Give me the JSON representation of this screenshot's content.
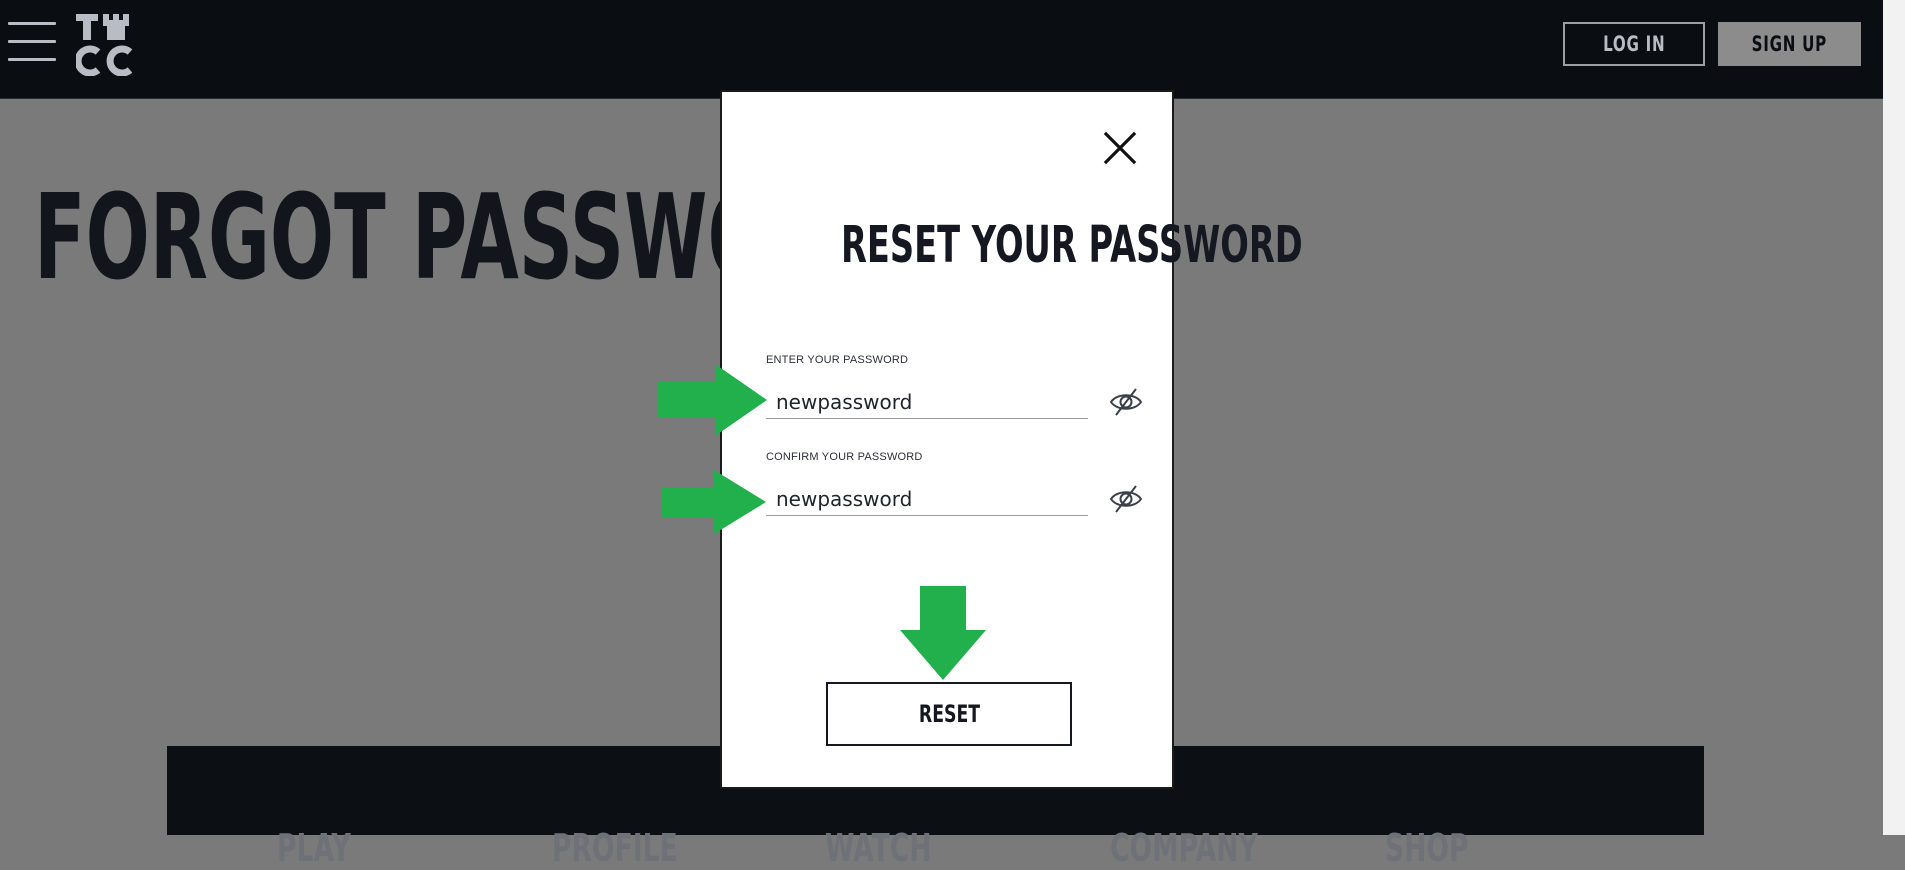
{
  "header": {
    "logo_text": "TMCC",
    "login_label": "LOG IN",
    "signup_label": "SIGN UP"
  },
  "page": {
    "title": "FORGOT PASSWORD?"
  },
  "footer_nav": [
    "PLAY",
    "PROFILE",
    "WATCH",
    "COMPANY",
    "SHOP"
  ],
  "modal": {
    "title": "RESET YOUR PASSWORD",
    "password_label": "ENTER YOUR PASSWORD",
    "password_value": "newpassword",
    "confirm_label": "CONFIRM YOUR PASSWORD",
    "confirm_value": "newpassword",
    "reset_label": "RESET"
  },
  "icons": [
    "hamburger-icon",
    "close-icon",
    "eye-off-icon"
  ],
  "colors": {
    "header_bg": "#0a0d12",
    "overlay": "#7a7a7a",
    "annotation_arrow": "#21b04b",
    "text_dark": "#151820"
  }
}
